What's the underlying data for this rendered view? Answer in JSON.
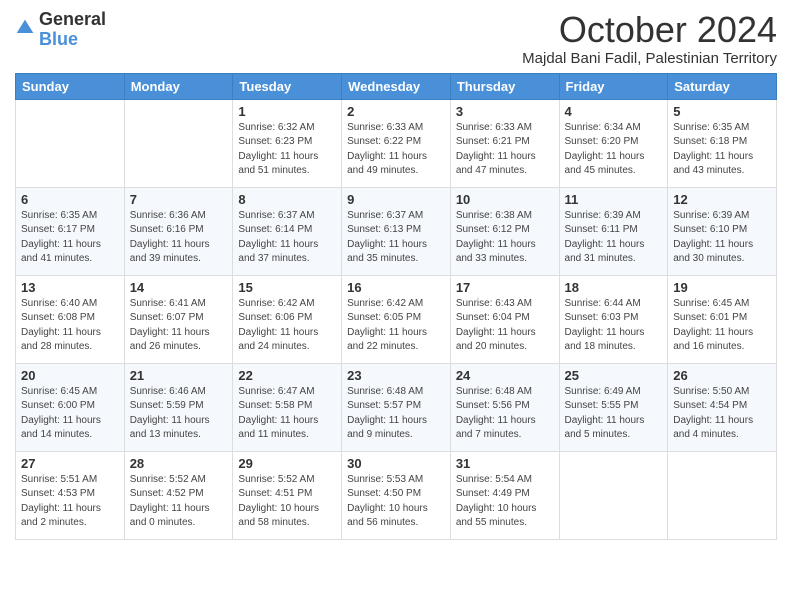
{
  "header": {
    "logo_general": "General",
    "logo_blue": "Blue",
    "month_title": "October 2024",
    "location": "Majdal Bani Fadil, Palestinian Territory"
  },
  "weekdays": [
    "Sunday",
    "Monday",
    "Tuesday",
    "Wednesday",
    "Thursday",
    "Friday",
    "Saturday"
  ],
  "weeks": [
    [
      {
        "day": "",
        "sunrise": "",
        "sunset": "",
        "daylight": ""
      },
      {
        "day": "",
        "sunrise": "",
        "sunset": "",
        "daylight": ""
      },
      {
        "day": "1",
        "sunrise": "Sunrise: 6:32 AM",
        "sunset": "Sunset: 6:23 PM",
        "daylight": "Daylight: 11 hours and 51 minutes."
      },
      {
        "day": "2",
        "sunrise": "Sunrise: 6:33 AM",
        "sunset": "Sunset: 6:22 PM",
        "daylight": "Daylight: 11 hours and 49 minutes."
      },
      {
        "day": "3",
        "sunrise": "Sunrise: 6:33 AM",
        "sunset": "Sunset: 6:21 PM",
        "daylight": "Daylight: 11 hours and 47 minutes."
      },
      {
        "day": "4",
        "sunrise": "Sunrise: 6:34 AM",
        "sunset": "Sunset: 6:20 PM",
        "daylight": "Daylight: 11 hours and 45 minutes."
      },
      {
        "day": "5",
        "sunrise": "Sunrise: 6:35 AM",
        "sunset": "Sunset: 6:18 PM",
        "daylight": "Daylight: 11 hours and 43 minutes."
      }
    ],
    [
      {
        "day": "6",
        "sunrise": "Sunrise: 6:35 AM",
        "sunset": "Sunset: 6:17 PM",
        "daylight": "Daylight: 11 hours and 41 minutes."
      },
      {
        "day": "7",
        "sunrise": "Sunrise: 6:36 AM",
        "sunset": "Sunset: 6:16 PM",
        "daylight": "Daylight: 11 hours and 39 minutes."
      },
      {
        "day": "8",
        "sunrise": "Sunrise: 6:37 AM",
        "sunset": "Sunset: 6:14 PM",
        "daylight": "Daylight: 11 hours and 37 minutes."
      },
      {
        "day": "9",
        "sunrise": "Sunrise: 6:37 AM",
        "sunset": "Sunset: 6:13 PM",
        "daylight": "Daylight: 11 hours and 35 minutes."
      },
      {
        "day": "10",
        "sunrise": "Sunrise: 6:38 AM",
        "sunset": "Sunset: 6:12 PM",
        "daylight": "Daylight: 11 hours and 33 minutes."
      },
      {
        "day": "11",
        "sunrise": "Sunrise: 6:39 AM",
        "sunset": "Sunset: 6:11 PM",
        "daylight": "Daylight: 11 hours and 31 minutes."
      },
      {
        "day": "12",
        "sunrise": "Sunrise: 6:39 AM",
        "sunset": "Sunset: 6:10 PM",
        "daylight": "Daylight: 11 hours and 30 minutes."
      }
    ],
    [
      {
        "day": "13",
        "sunrise": "Sunrise: 6:40 AM",
        "sunset": "Sunset: 6:08 PM",
        "daylight": "Daylight: 11 hours and 28 minutes."
      },
      {
        "day": "14",
        "sunrise": "Sunrise: 6:41 AM",
        "sunset": "Sunset: 6:07 PM",
        "daylight": "Daylight: 11 hours and 26 minutes."
      },
      {
        "day": "15",
        "sunrise": "Sunrise: 6:42 AM",
        "sunset": "Sunset: 6:06 PM",
        "daylight": "Daylight: 11 hours and 24 minutes."
      },
      {
        "day": "16",
        "sunrise": "Sunrise: 6:42 AM",
        "sunset": "Sunset: 6:05 PM",
        "daylight": "Daylight: 11 hours and 22 minutes."
      },
      {
        "day": "17",
        "sunrise": "Sunrise: 6:43 AM",
        "sunset": "Sunset: 6:04 PM",
        "daylight": "Daylight: 11 hours and 20 minutes."
      },
      {
        "day": "18",
        "sunrise": "Sunrise: 6:44 AM",
        "sunset": "Sunset: 6:03 PM",
        "daylight": "Daylight: 11 hours and 18 minutes."
      },
      {
        "day": "19",
        "sunrise": "Sunrise: 6:45 AM",
        "sunset": "Sunset: 6:01 PM",
        "daylight": "Daylight: 11 hours and 16 minutes."
      }
    ],
    [
      {
        "day": "20",
        "sunrise": "Sunrise: 6:45 AM",
        "sunset": "Sunset: 6:00 PM",
        "daylight": "Daylight: 11 hours and 14 minutes."
      },
      {
        "day": "21",
        "sunrise": "Sunrise: 6:46 AM",
        "sunset": "Sunset: 5:59 PM",
        "daylight": "Daylight: 11 hours and 13 minutes."
      },
      {
        "day": "22",
        "sunrise": "Sunrise: 6:47 AM",
        "sunset": "Sunset: 5:58 PM",
        "daylight": "Daylight: 11 hours and 11 minutes."
      },
      {
        "day": "23",
        "sunrise": "Sunrise: 6:48 AM",
        "sunset": "Sunset: 5:57 PM",
        "daylight": "Daylight: 11 hours and 9 minutes."
      },
      {
        "day": "24",
        "sunrise": "Sunrise: 6:48 AM",
        "sunset": "Sunset: 5:56 PM",
        "daylight": "Daylight: 11 hours and 7 minutes."
      },
      {
        "day": "25",
        "sunrise": "Sunrise: 6:49 AM",
        "sunset": "Sunset: 5:55 PM",
        "daylight": "Daylight: 11 hours and 5 minutes."
      },
      {
        "day": "26",
        "sunrise": "Sunrise: 5:50 AM",
        "sunset": "Sunset: 4:54 PM",
        "daylight": "Daylight: 11 hours and 4 minutes."
      }
    ],
    [
      {
        "day": "27",
        "sunrise": "Sunrise: 5:51 AM",
        "sunset": "Sunset: 4:53 PM",
        "daylight": "Daylight: 11 hours and 2 minutes."
      },
      {
        "day": "28",
        "sunrise": "Sunrise: 5:52 AM",
        "sunset": "Sunset: 4:52 PM",
        "daylight": "Daylight: 11 hours and 0 minutes."
      },
      {
        "day": "29",
        "sunrise": "Sunrise: 5:52 AM",
        "sunset": "Sunset: 4:51 PM",
        "daylight": "Daylight: 10 hours and 58 minutes."
      },
      {
        "day": "30",
        "sunrise": "Sunrise: 5:53 AM",
        "sunset": "Sunset: 4:50 PM",
        "daylight": "Daylight: 10 hours and 56 minutes."
      },
      {
        "day": "31",
        "sunrise": "Sunrise: 5:54 AM",
        "sunset": "Sunset: 4:49 PM",
        "daylight": "Daylight: 10 hours and 55 minutes."
      },
      {
        "day": "",
        "sunrise": "",
        "sunset": "",
        "daylight": ""
      },
      {
        "day": "",
        "sunrise": "",
        "sunset": "",
        "daylight": ""
      }
    ]
  ]
}
